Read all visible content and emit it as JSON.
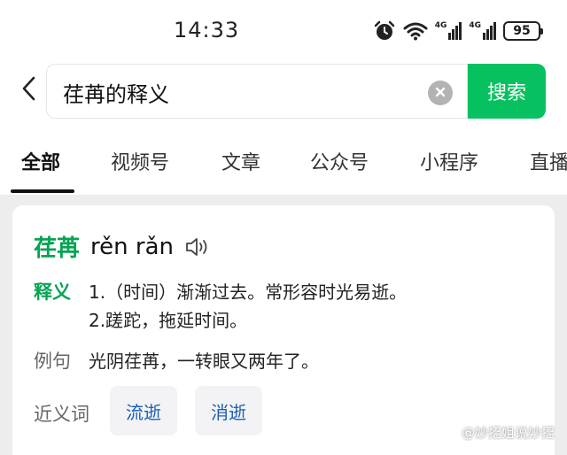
{
  "status_bar": {
    "time": "14:33",
    "icons": [
      "alarm-icon",
      "wifi-icon",
      "signal-4g-icon",
      "signal-4g-icon"
    ],
    "network_label_1": "4G",
    "network_label_2": "4G",
    "battery": "95"
  },
  "search": {
    "query": "荏苒的释义",
    "button_label": "搜索",
    "back_icon": "chevron-left-icon",
    "clear_icon": "clear-icon"
  },
  "tabs": [
    {
      "label": "全部",
      "active": true
    },
    {
      "label": "视频号",
      "active": false
    },
    {
      "label": "文章",
      "active": false
    },
    {
      "label": "公众号",
      "active": false
    },
    {
      "label": "小程序",
      "active": false
    },
    {
      "label": "直播",
      "active": false
    }
  ],
  "card": {
    "headword": "荏苒",
    "pinyin": "rěn rǎn",
    "speaker_icon": "speaker-icon",
    "definition_label": "释义",
    "definitions": [
      "1.（时间）渐渐过去。常形容时光易逝。",
      "2.蹉跎，拖延时间。"
    ],
    "example_label": "例句",
    "example": "光阴荏苒，一转眼又两年了。",
    "synonym_label": "近义词",
    "synonyms": [
      "流逝",
      "消逝"
    ]
  },
  "watermark": "@妙招姐说妙招",
  "colors": {
    "accent_green": "#07c160",
    "headword_green": "#07a352",
    "chip_text": "#1a5fb4"
  }
}
